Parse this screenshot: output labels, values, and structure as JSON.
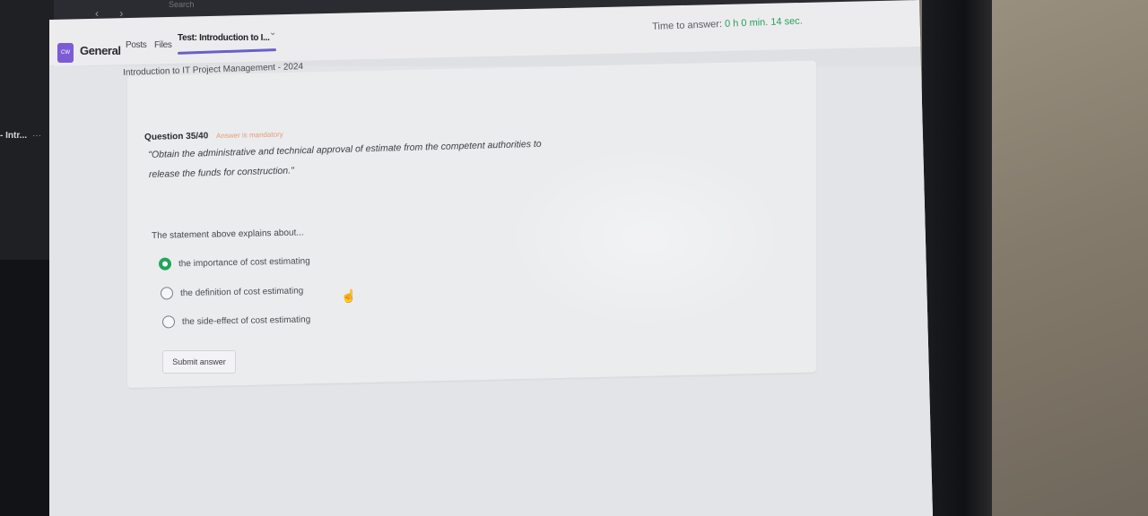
{
  "titlebar": {
    "nav": "‹ ›",
    "search": "Search"
  },
  "team": {
    "avatar": "CW",
    "name": "General"
  },
  "tabs": {
    "posts": "Posts",
    "files": "Files",
    "active": "Test: Introduction to I...",
    "caret": "⌄"
  },
  "timer": {
    "label": "Time to answer:",
    "value": "0 h 0 min. 14 sec."
  },
  "course": {
    "title": "Introduction to IT Project Management - 2024"
  },
  "sidebar": {
    "item": "- Intr...",
    "more": "···"
  },
  "question": {
    "number": "Question 35/40",
    "mandatory": "Answer is mandatory",
    "statement": "\"Obtain the administrative and technical approval of estimate from the competent authorities to release the funds for construction.\"",
    "prompt": "The statement above explains about...",
    "options": [
      "the importance of cost estimating",
      "the definition of cost estimating",
      "the side-effect of cost estimating"
    ],
    "selected_index": 0
  },
  "submit": {
    "label": "Submit answer"
  },
  "icons": {
    "cursor": "hand-pointer-icon"
  },
  "colors": {
    "accent": "#6a5fc9",
    "timer": "#28a05b",
    "mandatory": "#e69a78",
    "selected": "#22a45a"
  }
}
